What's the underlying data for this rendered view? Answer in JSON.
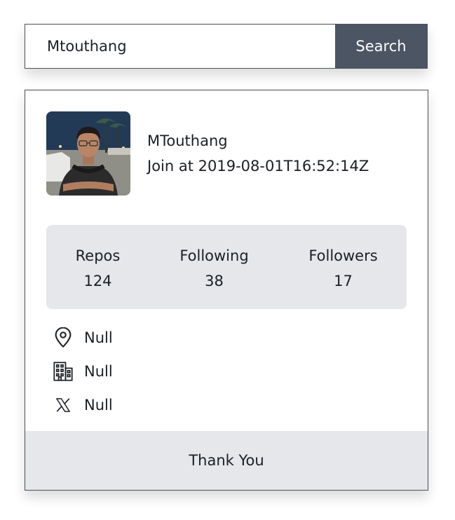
{
  "search": {
    "value": "Mtouthang",
    "button_label": "Search"
  },
  "profile": {
    "username": "MTouthang",
    "joined": "Join at 2019-08-01T16:52:14Z",
    "avatar_icon": "user-avatar-photo"
  },
  "stats": {
    "repos": {
      "label": "Repos",
      "value": "124"
    },
    "following": {
      "label": "Following",
      "value": "38"
    },
    "followers": {
      "label": "Followers",
      "value": "17"
    }
  },
  "details": {
    "location": {
      "icon": "map-pin-icon",
      "value": "Null"
    },
    "company": {
      "icon": "building-icon",
      "value": "Null"
    },
    "twitter": {
      "icon": "x-logo-icon",
      "value": "Null"
    }
  },
  "footer": {
    "text": "Thank You"
  },
  "colors": {
    "button_bg": "#4b5563",
    "panel_bg": "#e5e7eb",
    "border": "#4a505a"
  }
}
